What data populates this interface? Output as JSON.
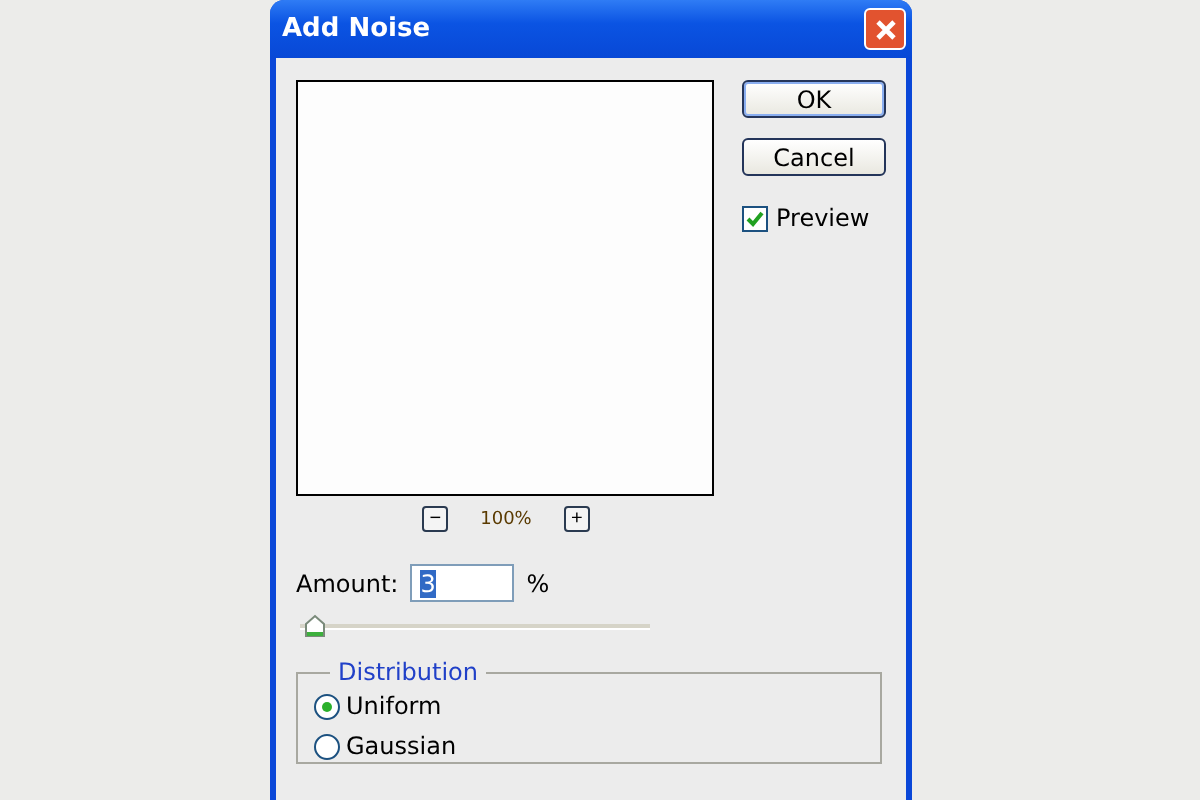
{
  "window": {
    "title": "Add Noise"
  },
  "buttons": [
    {
      "label": "OK",
      "selected": true
    },
    {
      "label": "Cancel",
      "selected": false
    }
  ],
  "preview": {
    "label": "Preview",
    "checked": true
  },
  "zoom": {
    "minus": "−",
    "level_text": "100%",
    "plus": "+"
  },
  "amount": {
    "label": "Amount:",
    "value": "3",
    "unit": "%",
    "level": 0.01
  },
  "distribution": {
    "title": "Distribution",
    "options": [
      {
        "label": "Uniform",
        "selected": true
      },
      {
        "label": "Gaussian",
        "selected": false
      }
    ]
  }
}
